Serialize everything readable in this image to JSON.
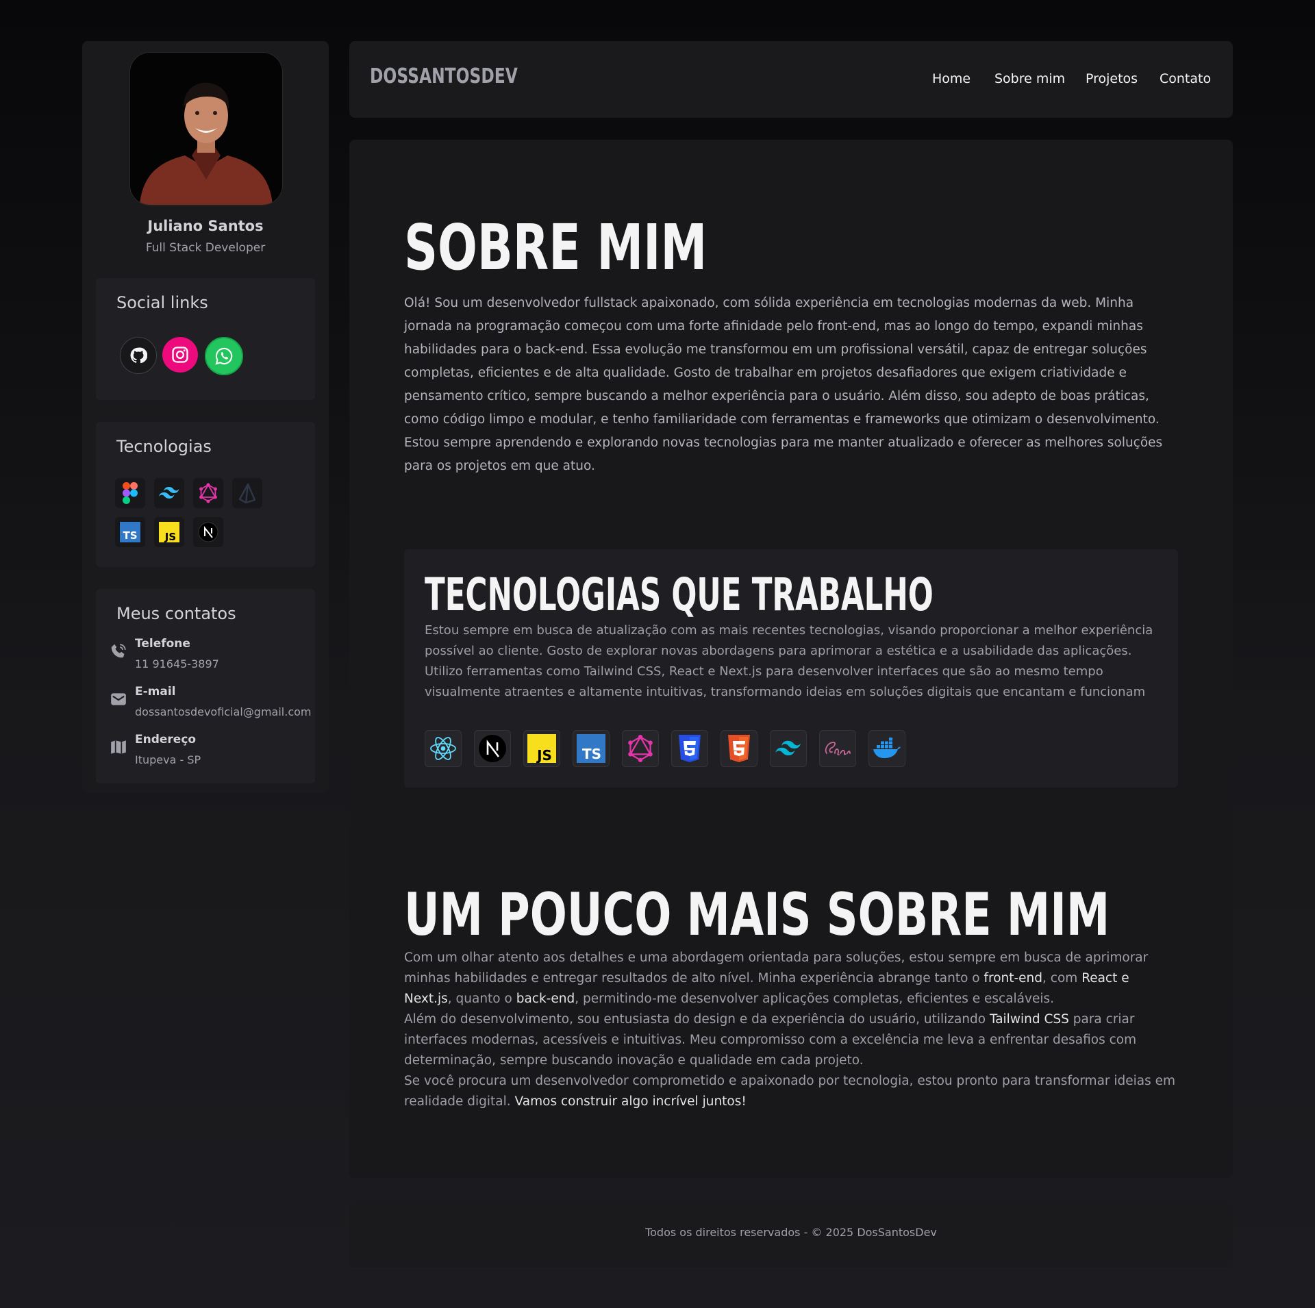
{
  "sidebar": {
    "name": "Juliano Santos",
    "role": "Full Stack Developer",
    "social_title": "Social links",
    "social": [
      {
        "icon": "github-icon",
        "color": "#18181b"
      },
      {
        "icon": "instagram-icon",
        "color": "#ec0a7c"
      },
      {
        "icon": "whatsapp-icon",
        "color": "#22c55e"
      }
    ],
    "tech_title": "Tecnologias",
    "tech_icons": [
      "figma-icon",
      "tailwind-icon",
      "graphql-icon",
      "prisma-icon",
      "typescript-icon",
      "javascript-icon",
      "nextjs-icon"
    ],
    "contacts_title": "Meus contatos",
    "contacts": [
      {
        "icon": "phone-icon",
        "label": "Telefone",
        "value": "11 91645-3897"
      },
      {
        "icon": "mail-icon",
        "label": "E-mail",
        "value": "dossantosdevoficial@gmail.com"
      },
      {
        "icon": "map-icon",
        "label": "Endereço",
        "value": "Itupeva - SP"
      }
    ]
  },
  "header": {
    "logo": "DOSSANTOSDEV",
    "nav": [
      "Home",
      "Sobre mim",
      "Projetos",
      "Contato"
    ]
  },
  "main": {
    "about_title": "SOBRE MIM",
    "about_text": "Olá! Sou um desenvolvedor fullstack apaixonado, com sólida experiência em tecnologias modernas da web. Minha jornada na programação começou com uma forte afinidade pelo front-end, mas ao longo do tempo, expandi minhas habilidades para o back-end. Essa evolução me transformou em um profissional versátil, capaz de entregar soluções completas, eficientes e de alta qualidade. Gosto de trabalhar em projetos desafiadores que exigem criatividade e pensamento crítico, sempre buscando a melhor experiência para o usuário. Além disso, sou adepto de boas práticas, como código limpo e modular, e tenho familiaridade com ferramentas e frameworks que otimizam o desenvolvimento. Estou sempre aprendendo e explorando novas tecnologias para me manter atualizado e oferecer as melhores soluções para os projetos em que atuo.",
    "tech_title": "TECNOLOGIAS QUE TRABALHO",
    "tech_text": "Estou sempre em busca de atualização com as mais recentes tecnologias, visando proporcionar a melhor experiência possível ao cliente. Gosto de explorar novas abordagens para aprimorar a estética e a usabilidade das aplicações. Utilizo ferramentas como Tailwind CSS, React e Next.js para desenvolver interfaces que são ao mesmo tempo visualmente atraentes e altamente intuitivas, transformando ideias em soluções digitais que encantam e funcionam",
    "tech_icons": [
      "react-icon",
      "nextjs-icon",
      "javascript-icon",
      "typescript-icon",
      "graphql-icon",
      "css3-icon",
      "html5-icon",
      "tailwind-icon",
      "sass-icon",
      "docker-icon"
    ],
    "more_title": "UM POUCO MAIS SOBRE MIM",
    "more": {
      "p1a": "Com um olhar atento aos detalhes e uma abordagem orientada para soluções, estou sempre em busca de aprimorar minhas habilidades e entregar resultados de alto nível. Minha experiência abrange tanto o ",
      "p1b": "front-end",
      "p1c": ", com ",
      "p1d": "React e Next.js",
      "p1e": ", quanto o ",
      "p1f": "back-end",
      "p1g": ", permitindo-me desenvolver aplicações completas, eficientes e escaláveis.",
      "p2a": "Além do desenvolvimento, sou entusiasta do design e da experiência do usuário, utilizando ",
      "p2b": "Tailwind CSS",
      "p2c": " para criar interfaces modernas, acessíveis e intuitivas. Meu compromisso com a excelência me leva a enfrentar desafios com determinação, sempre buscando inovação e qualidade em cada projeto.",
      "p3a": "Se você procura um desenvolvedor comprometido e apaixonado por tecnologia, estou pronto para transformar ideias em realidade digital. ",
      "p3b": "Vamos construir algo incrível juntos!"
    }
  },
  "footer": {
    "text": "Todos os direitos reservados - © 2025 DosSantosDev"
  }
}
